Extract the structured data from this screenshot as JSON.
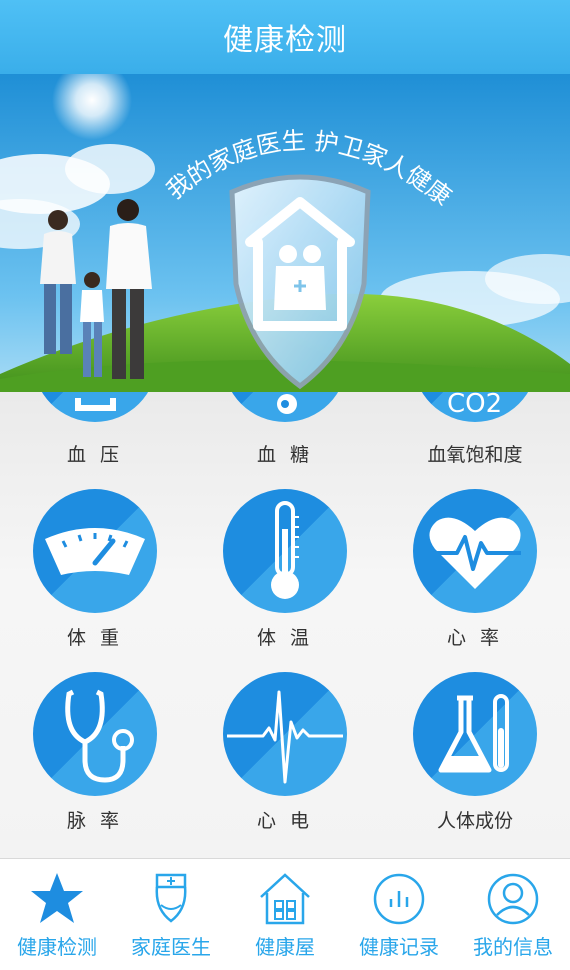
{
  "header": {
    "title": "健康检测"
  },
  "banner": {
    "slogan": "我的家庭医生  护卫家人健康"
  },
  "grid": {
    "partial": [
      {
        "label": "血 压",
        "icon": "blood-pressure-icon"
      },
      {
        "label": "血 糖",
        "icon": "blood-sugar-icon"
      },
      {
        "label": "血氧饱和度",
        "icon": "co2-icon",
        "icon_text": "CO2"
      }
    ],
    "rows": [
      [
        {
          "label": "体 重",
          "icon": "scale-icon"
        },
        {
          "label": "体 温",
          "icon": "thermometer-icon"
        },
        {
          "label": "心 率",
          "icon": "heart-rate-icon"
        }
      ],
      [
        {
          "label": "脉 率",
          "icon": "stethoscope-icon"
        },
        {
          "label": "心 电",
          "icon": "ecg-icon"
        },
        {
          "label": "人体成份",
          "icon": "flask-icon"
        }
      ]
    ]
  },
  "tabbar": {
    "items": [
      {
        "label": "健康检测",
        "icon": "star-icon",
        "active": true
      },
      {
        "label": "家庭医生",
        "icon": "doctor-icon"
      },
      {
        "label": "健康屋",
        "icon": "house-icon"
      },
      {
        "label": "健康记录",
        "icon": "record-icon"
      },
      {
        "label": "我的信息",
        "icon": "profile-icon"
      }
    ]
  },
  "colors": {
    "header": "#3fb6ef",
    "circle_dark": "#1e8de0",
    "circle_light": "#39a6ea",
    "tab_active": "#29a6ea"
  }
}
